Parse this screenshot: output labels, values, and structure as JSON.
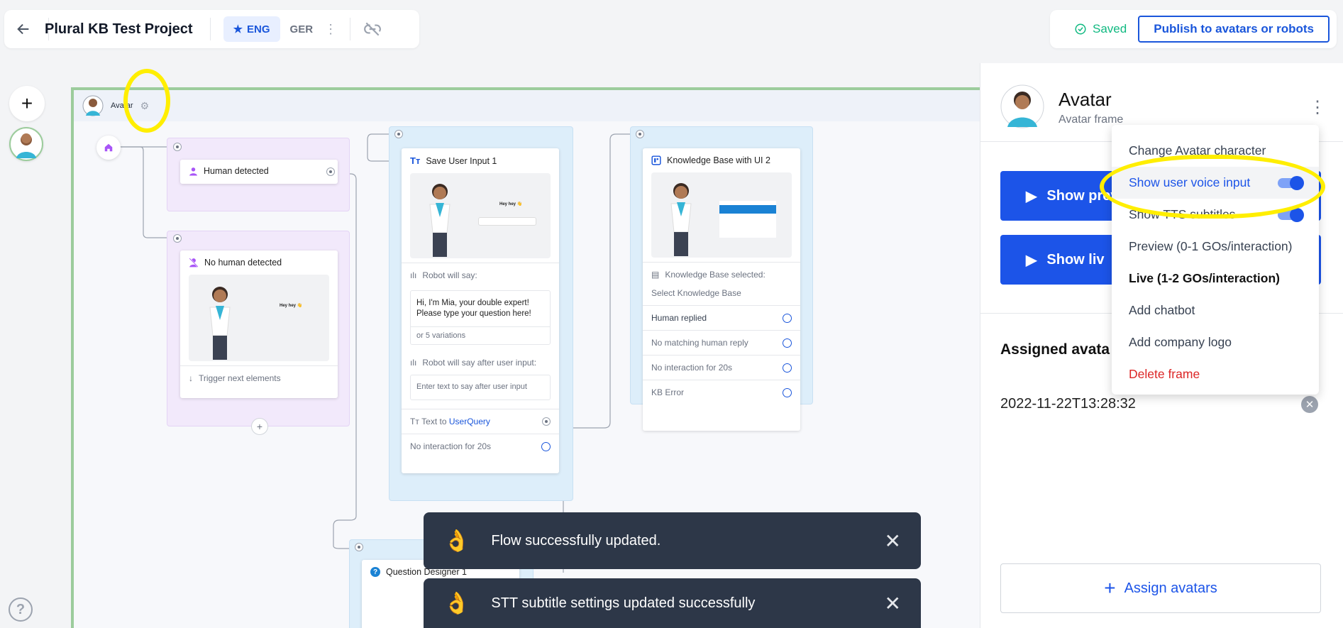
{
  "header": {
    "title": "Plural KB Test Project",
    "lang_active": "ENG",
    "lang_other": "GER",
    "saved": "Saved",
    "publish": "Publish to avatars or robots"
  },
  "frame": {
    "label": "Avatar"
  },
  "nodes": {
    "human": {
      "title": "Human detected"
    },
    "nohuman": {
      "title": "No human detected",
      "bubble": "Hey hey 👋",
      "trigger": "Trigger next elements"
    },
    "save": {
      "title": "Save User Input 1",
      "bubble": "Hey hey 👋",
      "robot_say": "Robot will say:",
      "message": "Hi, I'm Mia, your double expert! Please type your question here!",
      "variations": "or 5 variations",
      "robot_after": "Robot will say after user input:",
      "after_placeholder": "Enter text to say after user input",
      "text_to": "Text to",
      "query": "UserQuery",
      "no_interaction": "No interaction for 20s"
    },
    "kb": {
      "title": "Knowledge Base with UI 2",
      "kb_selected": "Knowledge Base selected:",
      "select_kb": "Select Knowledge Base",
      "human_replied": "Human replied",
      "no_match": "No matching human reply",
      "no_interaction": "No interaction for 20s",
      "kb_error": "KB Error"
    },
    "question": {
      "title": "Question Designer 1"
    }
  },
  "panel": {
    "title": "Avatar",
    "subtitle": "Avatar frame",
    "show_preview": "Show prev",
    "show_live": "Show liv",
    "assigned": "Assigned avata",
    "timestamp": "2022-11-22T13:28:32",
    "assign_btn": "Assign avatars"
  },
  "menu": {
    "items": [
      "Change Avatar character",
      "Show user voice input",
      "Show TTS subtitles",
      "Preview (0-1 GOs/interaction)",
      "Live (1-2 GOs/interaction)",
      "Add chatbot",
      "Add company logo",
      "Delete frame"
    ]
  },
  "toasts": [
    "Flow successfully updated.",
    "STT subtitle settings updated successfully"
  ],
  "colors": {
    "primary": "#1c54e8",
    "success": "#10b981",
    "danger": "#dc2626",
    "highlight": "#ffee00"
  }
}
